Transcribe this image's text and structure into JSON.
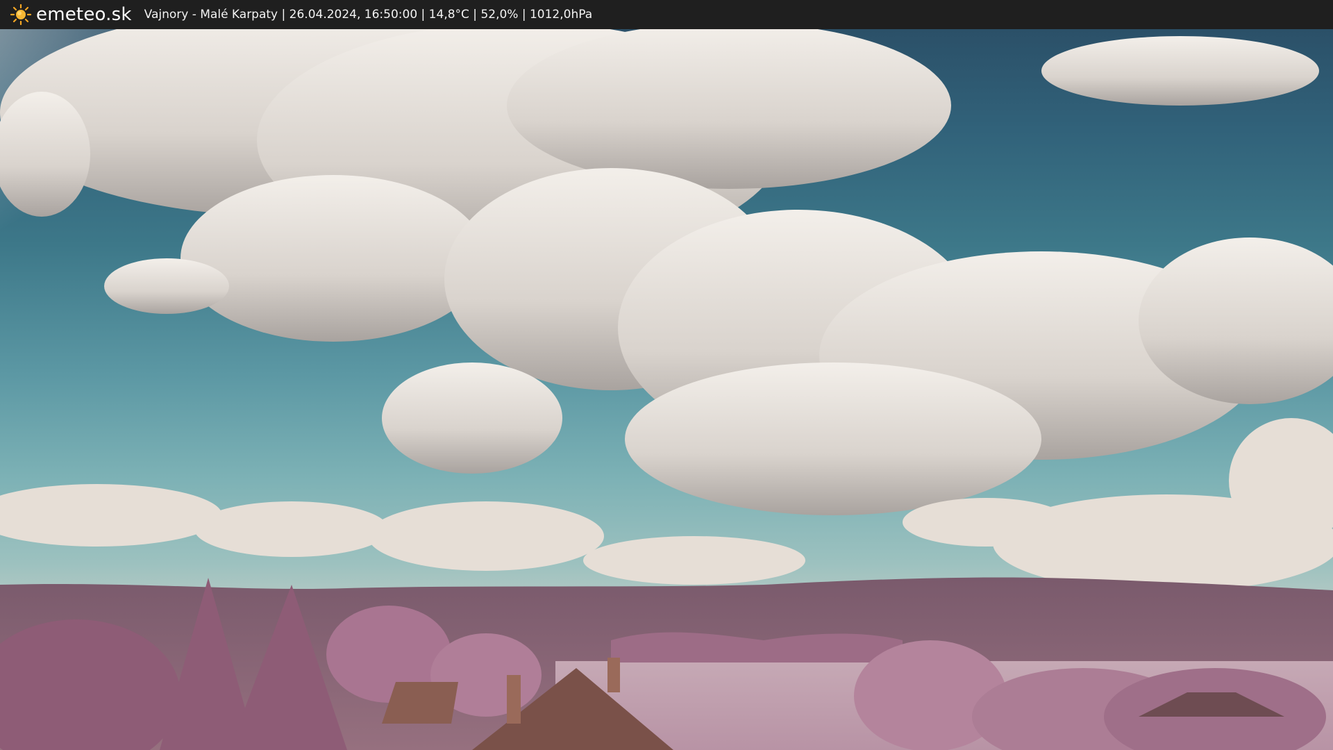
{
  "header": {
    "brand": "emeteo.sk",
    "caption": "Vajnory - Malé Karpaty | 26.04.2024, 16:50:00 | 14,8°C | 52,0% | 1012,0hPa",
    "icon": "sun-icon",
    "background_color": "#1f1f1f",
    "icon_color": "#f5a623"
  },
  "scene": {
    "colors": {
      "sky_top": "#2b5068",
      "sky_bottom": "#9cc1bf",
      "cloud": "#e9e4df",
      "hills": "#8c6577",
      "foliage": "#a9768f"
    }
  }
}
